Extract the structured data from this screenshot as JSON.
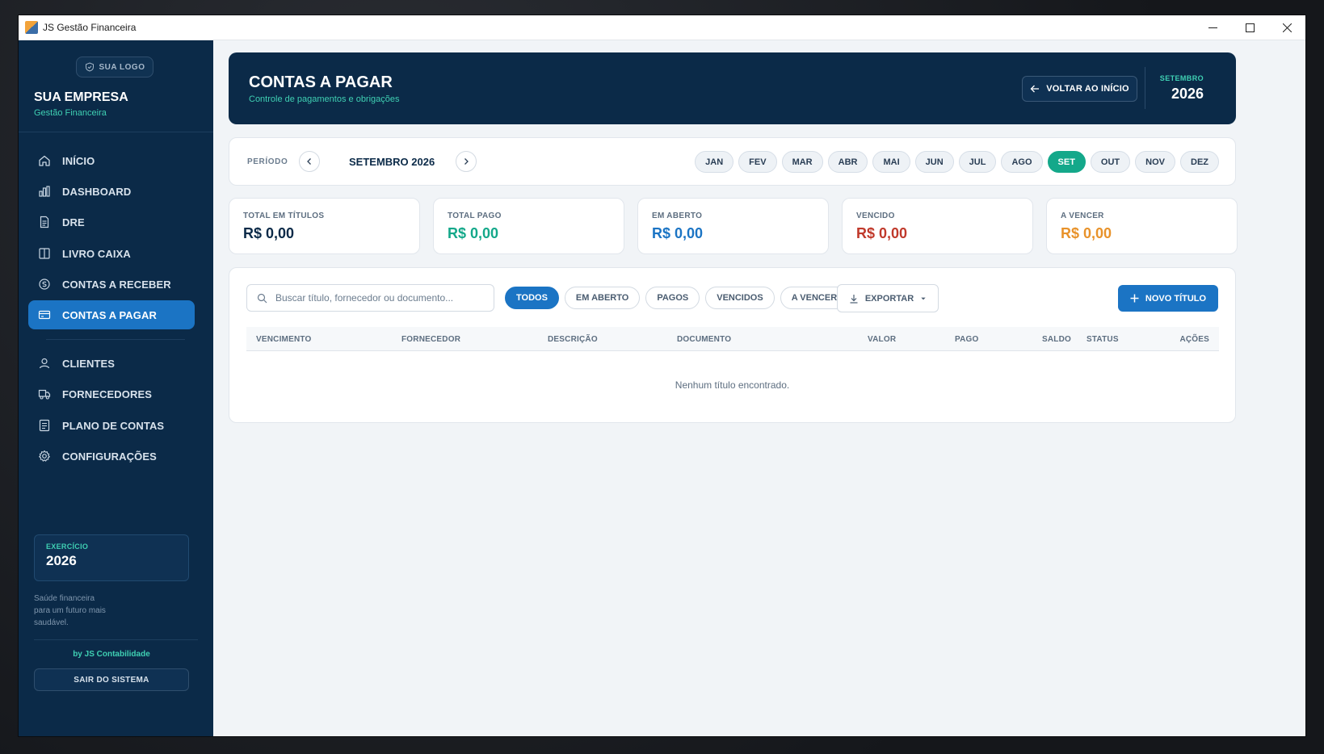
{
  "window": {
    "title": "JS Gestão Financeira"
  },
  "sidebar": {
    "logo_label": "SUA LOGO",
    "company_name": "SUA EMPRESA",
    "company_sub": "Gestão Financeira",
    "nav_main": [
      {
        "label": "INÍCIO",
        "icon": "home-icon"
      },
      {
        "label": "DASHBOARD",
        "icon": "bar-chart-icon"
      },
      {
        "label": "DRE",
        "icon": "document-icon"
      },
      {
        "label": "LIVRO CAIXA",
        "icon": "book-icon"
      },
      {
        "label": "CONTAS A RECEBER",
        "icon": "coin-icon"
      },
      {
        "label": "CONTAS A PAGAR",
        "icon": "credit-card-icon",
        "active": true
      }
    ],
    "nav_secondary": [
      {
        "label": "CLIENTES",
        "icon": "user-icon"
      },
      {
        "label": "FORNECEDORES",
        "icon": "truck-icon"
      },
      {
        "label": "PLANO DE CONTAS",
        "icon": "list-icon"
      },
      {
        "label": "CONFIGURAÇÕES",
        "icon": "gear-icon"
      }
    ],
    "exercise_label": "EXERCÍCIO",
    "exercise_year": "2026",
    "tagline": "Saúde financeira para um futuro mais saudável.",
    "credit": "by JS Contabilidade",
    "logout_label": "SAIR DO SISTEMA"
  },
  "header": {
    "title": "CONTAS A PAGAR",
    "subtitle": "Controle de pagamentos e obrigações",
    "back_label": "VOLTAR AO INÍCIO",
    "month": "SETEMBRO",
    "year": "2026"
  },
  "period": {
    "label": "PERÍODO",
    "value": "SETEMBRO 2026",
    "months": [
      "JAN",
      "FEV",
      "MAR",
      "ABR",
      "MAI",
      "JUN",
      "JUL",
      "AGO",
      "SET",
      "OUT",
      "NOV",
      "DEZ"
    ],
    "active_month": "SET"
  },
  "stats": [
    {
      "label": "TOTAL EM TÍTULOS",
      "value": "R$ 0,00",
      "color": "#0b2a48"
    },
    {
      "label": "TOTAL PAGO",
      "value": "R$ 0,00",
      "color": "#14a88a"
    },
    {
      "label": "EM ABERTO",
      "value": "R$ 0,00",
      "color": "#1b74c4"
    },
    {
      "label": "VENCIDO",
      "value": "R$ 0,00",
      "color": "#c0392b"
    },
    {
      "label": "A VENCER",
      "value": "R$ 0,00",
      "color": "#e8922a"
    }
  ],
  "table": {
    "search_placeholder": "Buscar título, fornecedor ou documento...",
    "filters": [
      "TODOS",
      "EM ABERTO",
      "PAGOS",
      "VENCIDOS",
      "A VENCER"
    ],
    "active_filter": "TODOS",
    "export_label": "EXPORTAR",
    "new_label": "NOVO TÍTULO",
    "columns": [
      "VENCIMENTO",
      "FORNECEDOR",
      "DESCRIÇÃO",
      "DOCUMENTO",
      "VALOR",
      "PAGO",
      "SALDO",
      "STATUS",
      "AÇÕES"
    ],
    "empty_message": "Nenhum título encontrado."
  },
  "colors": {
    "sidebar_bg": "#0b2a48",
    "accent_blue": "#1b74c4",
    "accent_teal": "#14a88a"
  }
}
